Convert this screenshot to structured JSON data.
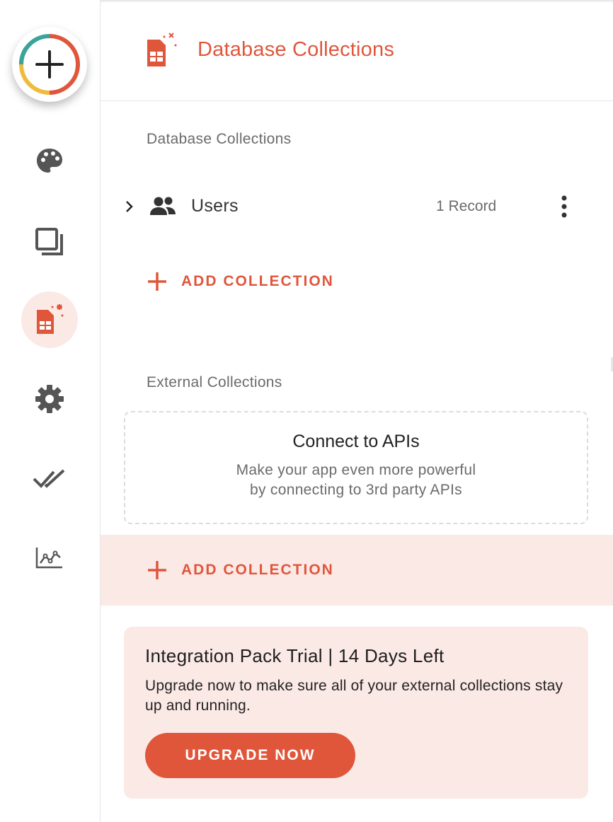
{
  "header": {
    "title": "Database Collections"
  },
  "sections": {
    "database_label": "Database Collections",
    "external_label": "External Collections"
  },
  "collections": [
    {
      "name": "Users",
      "count": "1 Record"
    }
  ],
  "actions": {
    "add_collection_db": "ADD COLLECTION",
    "add_collection_ext": "ADD COLLECTION"
  },
  "api_card": {
    "title": "Connect to APIs",
    "line1": "Make your app even more powerful",
    "line2": "by connecting to 3rd party APIs"
  },
  "trial": {
    "title": "Integration Pack Trial | 14 Days Left",
    "body": "Upgrade now to make sure all of your external collections stay up and running.",
    "button": "UPGRADE NOW"
  },
  "icons": {
    "fab": "plus-icon",
    "rail": [
      "palette-icon",
      "screens-icon",
      "database-icon",
      "gear-icon",
      "double-check-icon",
      "analytics-icon"
    ]
  },
  "colors": {
    "accent": "#e0563b",
    "accent_light": "#fbe9e6",
    "ring_teal": "#3aa39a",
    "ring_red": "#e0563b",
    "ring_yellow": "#f0bb3c",
    "icon_gray": "#555555"
  }
}
